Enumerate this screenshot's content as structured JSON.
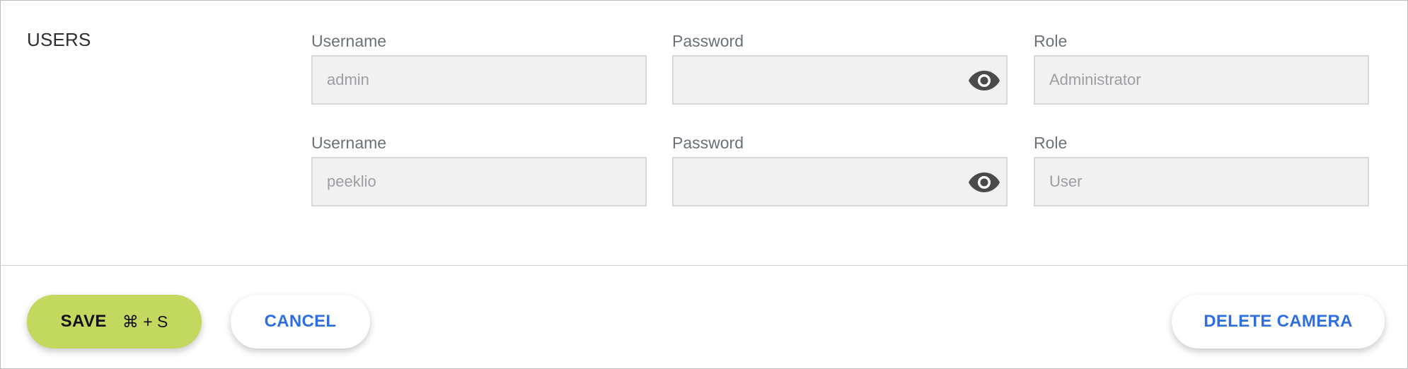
{
  "users_section": {
    "title": "USERS",
    "rows": [
      {
        "username_label": "Username",
        "username_value": "admin",
        "password_label": "Password",
        "password_value": "",
        "role_label": "Role",
        "role_value": "Administrator"
      },
      {
        "username_label": "Username",
        "username_value": "peeklio",
        "password_label": "Password",
        "password_value": "",
        "role_label": "Role",
        "role_value": "User"
      }
    ]
  },
  "actions": {
    "save_label": "SAVE",
    "save_shortcut": "⌘ + S",
    "cancel_label": "CANCEL",
    "delete_label": "DELETE CAMERA"
  },
  "icons": {
    "show_password": "eye-icon"
  },
  "colors": {
    "save_button": "#c3d85e",
    "link_blue": "#2f6ee0",
    "field_background": "#f1f1f1"
  }
}
